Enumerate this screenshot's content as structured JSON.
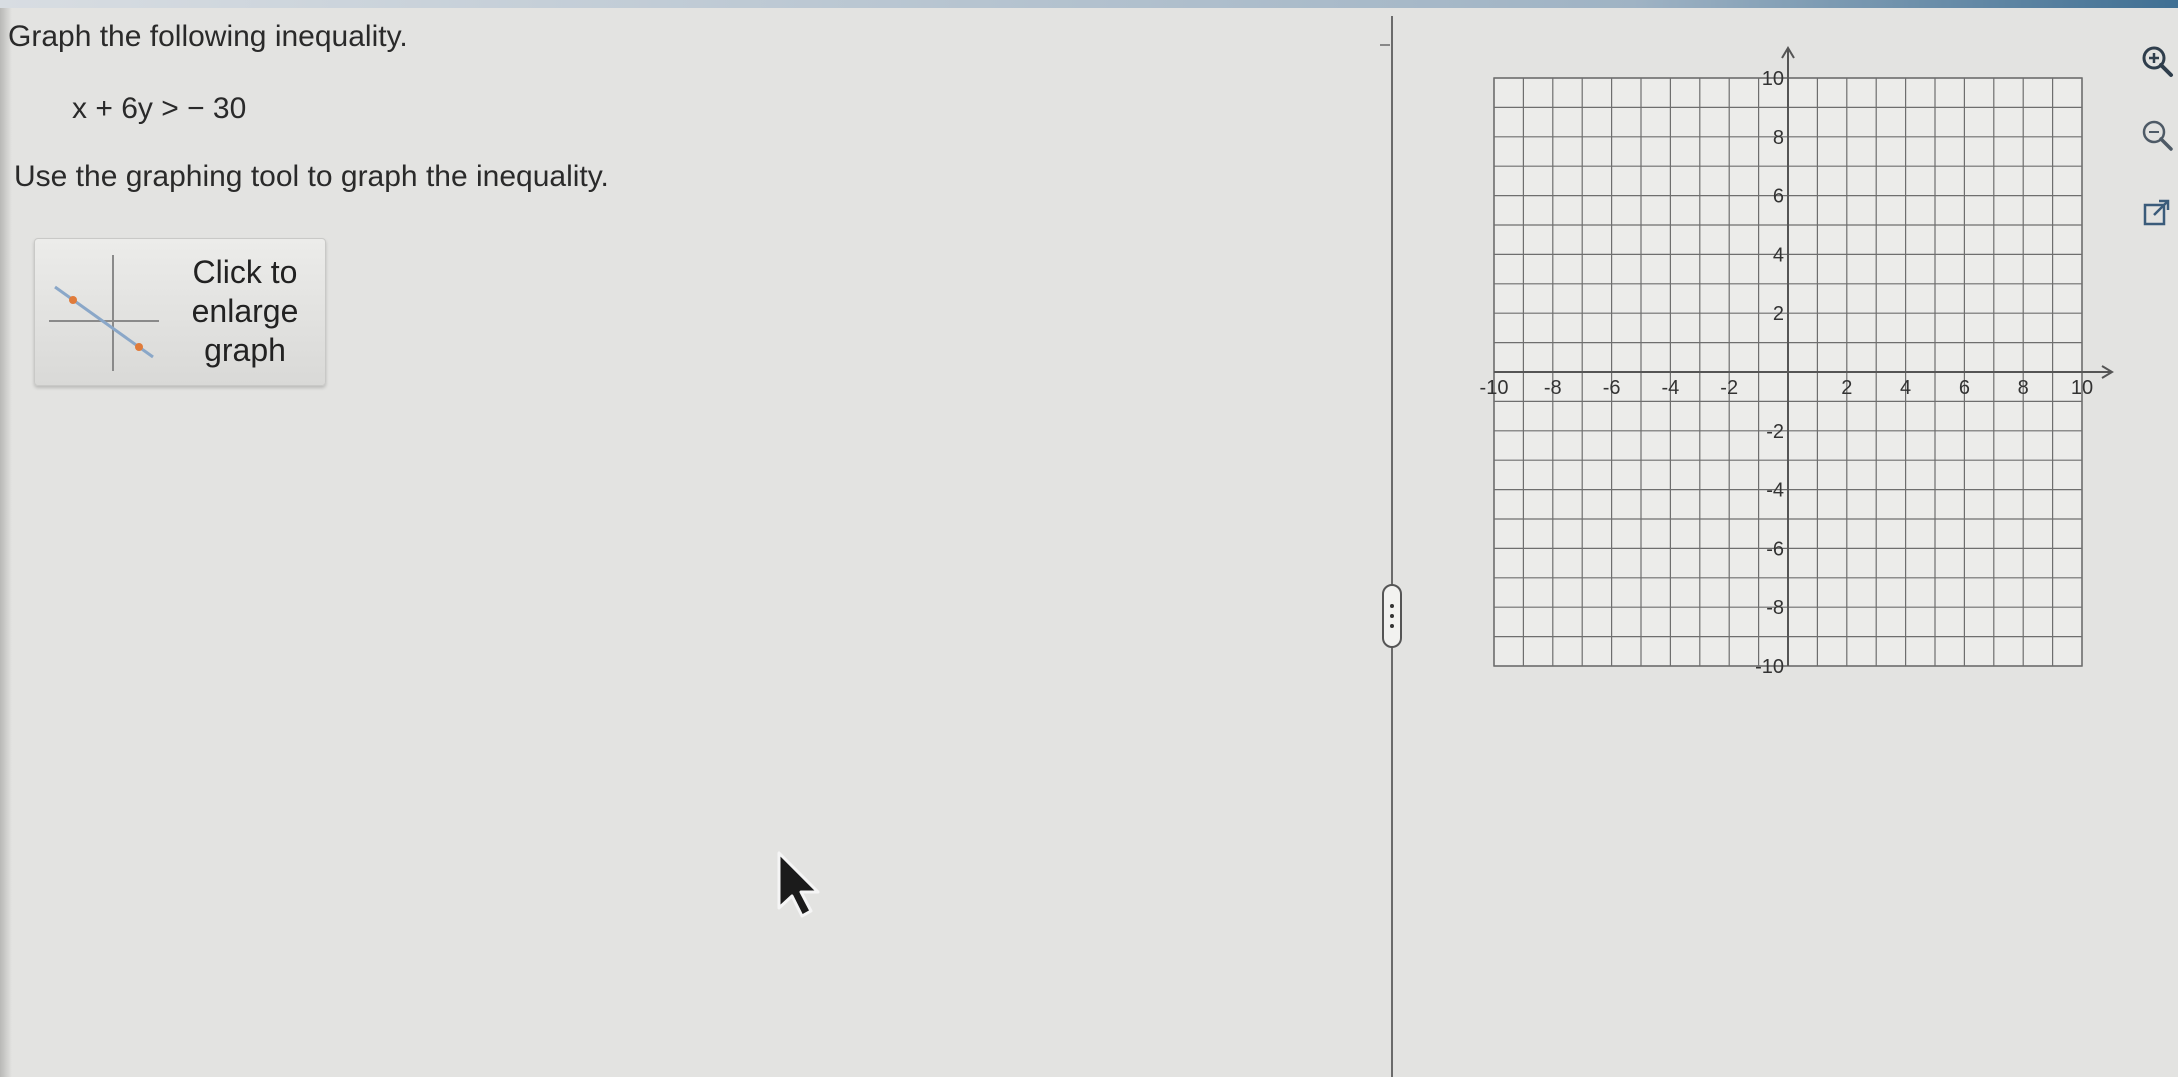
{
  "problem": {
    "instruction": "Graph the following inequality.",
    "inequality": "x + 6y > − 30",
    "tool_text": "Use the graphing tool to graph the inequality."
  },
  "enlarge_button": {
    "label_line1": "Click to",
    "label_line2": "enlarge",
    "label_line3": "graph"
  },
  "graph": {
    "x_range": [
      -10,
      10
    ],
    "y_range": [
      -10,
      10
    ],
    "grid_step": 1,
    "x_tick_labels": [
      "-10",
      "-8",
      "-6",
      "-4",
      "-2",
      "2",
      "4",
      "6",
      "8",
      "10"
    ],
    "y_tick_labels": [
      "10",
      "8",
      "6",
      "4",
      "2",
      "-2",
      "-4",
      "-6",
      "-8",
      "-10"
    ],
    "grid_color": "#6e6e6e",
    "axis_color": "#555555"
  },
  "side_tools": [
    {
      "name": "zoom-in-icon",
      "label": "Zoom in"
    },
    {
      "name": "zoom-out-icon",
      "label": "Zoom out"
    },
    {
      "name": "open-external-icon",
      "label": "Open in new window"
    }
  ],
  "colors": {
    "background": "#e3e3e1",
    "accent": "#3f6f93",
    "thumb_line": "#8aa7c8",
    "thumb_point": "#e07b3a"
  }
}
